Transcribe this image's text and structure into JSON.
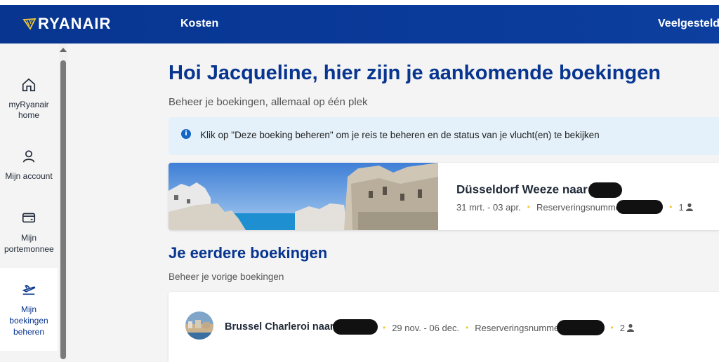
{
  "header": {
    "logo_text": "RYANAIR",
    "nav": {
      "costs": "Kosten",
      "faq": "Veelgestelde"
    }
  },
  "sidebar": {
    "items": [
      {
        "label": "myRyanair home",
        "icon": "home-icon"
      },
      {
        "label": "Mijn account",
        "icon": "user-icon"
      },
      {
        "label": "Mijn portemonnee",
        "icon": "wallet-icon"
      },
      {
        "label": "Mijn boekingen beheren",
        "icon": "plane-takeoff-icon",
        "active": true
      }
    ]
  },
  "main": {
    "title": "Hoi Jacqueline, hier zijn je aankomende boekingen",
    "subtitle": "Beheer je boekingen, allemaal op één plek",
    "info_banner": {
      "icon": "i",
      "text": "Klik op \"Deze boeking beheren\" om je reis te beheren en de status van je vlucht(en) te bekijken"
    },
    "upcoming": [
      {
        "route": "Düsseldorf Weeze naar",
        "dates": "31 mrt. - 03 apr.",
        "reservation_label": "Reserveringsnummer",
        "passengers": "1"
      }
    ],
    "past_section": {
      "title": "Je eerdere boekingen",
      "subtitle": "Beheer je vorige boekingen"
    },
    "past": [
      {
        "route": "Brussel Charleroi naar",
        "dates": "29 nov. - 06 dec.",
        "reservation_label": "Reserveringsnummer",
        "passengers": "2"
      }
    ]
  },
  "colors": {
    "brand_blue": "#073590",
    "accent_yellow": "#f1c933",
    "info_bg": "#e4f1fa"
  }
}
